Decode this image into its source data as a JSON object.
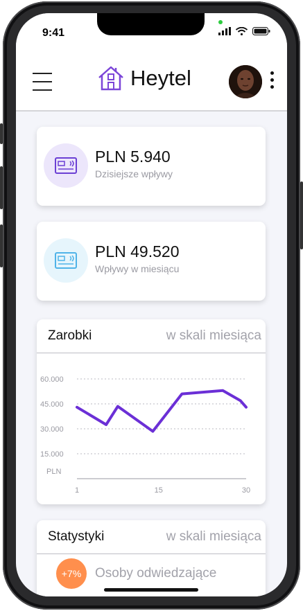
{
  "status_bar": {
    "time": "9:41"
  },
  "header": {
    "brand": "Heytel"
  },
  "income_cards": [
    {
      "value": "PLN 5.940",
      "label": "Dzisiejsze wpływy",
      "accent": "#6b3fd4",
      "icon_bg": "#ece6fb",
      "icon": "card-icon"
    },
    {
      "value": "PLN 49.520",
      "label": "Wpływy w miesiącu",
      "accent": "#4fb3e8",
      "icon_bg": "#e6f5fc",
      "icon": "card-icon"
    }
  ],
  "earnings": {
    "title": "Zarobki",
    "subtitle": "w skali miesiąca"
  },
  "chart_data": {
    "type": "line",
    "x": [
      1,
      6,
      8,
      14,
      19,
      26,
      29,
      30
    ],
    "y": [
      43000,
      32500,
      43500,
      28500,
      51000,
      53000,
      47000,
      43000
    ],
    "y_ticks": [
      "60.000",
      "45.000",
      "30.000",
      "15.000"
    ],
    "ylabel": "PLN",
    "x_ticks": [
      "1",
      "15",
      "30"
    ],
    "xlim": [
      1,
      30
    ],
    "ylim": [
      0,
      60000
    ],
    "grid": "dotted horizontal",
    "line_color": "#6b2fd6"
  },
  "statistics": {
    "title": "Statystyki",
    "subtitle": "w skali miesiąca",
    "items": [
      {
        "badge": "+7%",
        "label": "Osoby odwiedzające",
        "badge_color": "#ff8f4d"
      }
    ]
  }
}
